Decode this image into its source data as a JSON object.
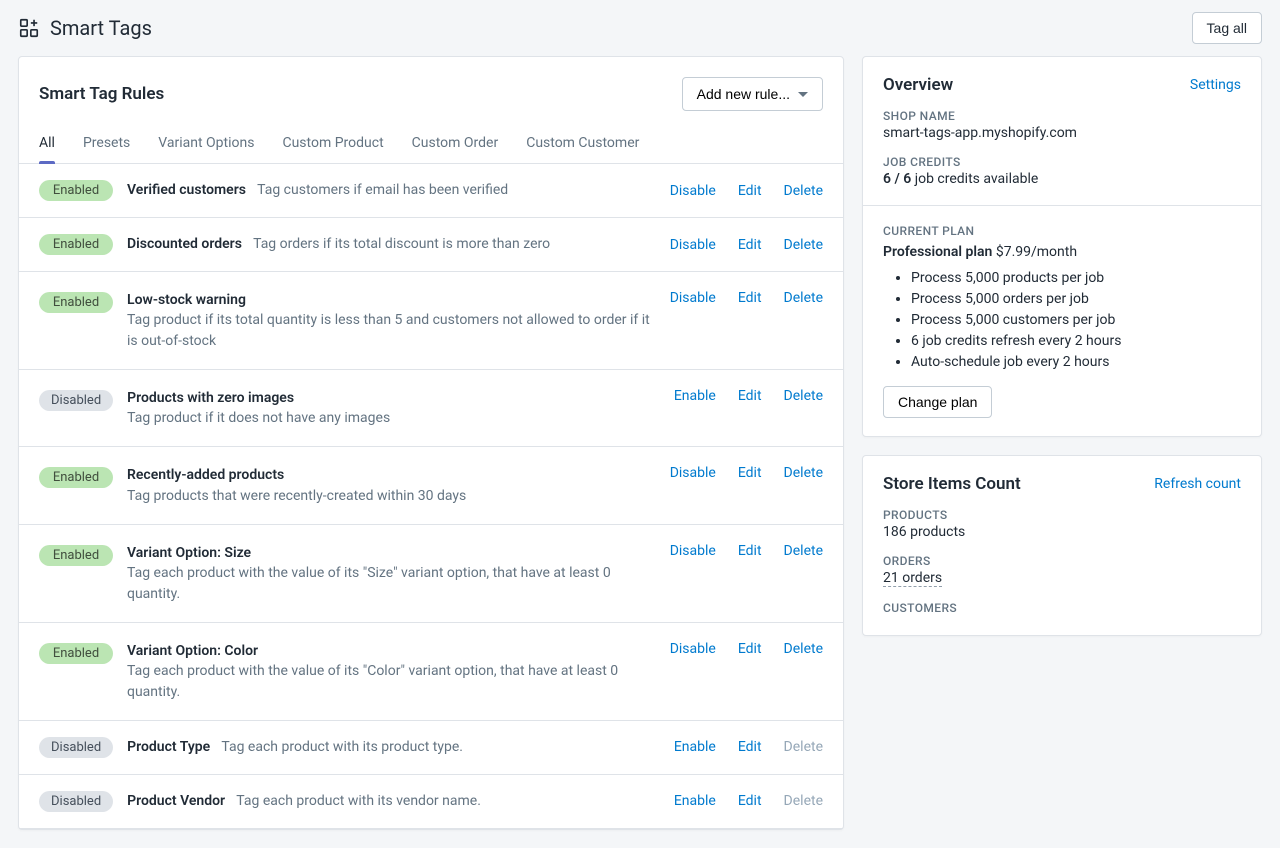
{
  "app_title": "Smart Tags",
  "tag_all_label": "Tag all",
  "rules_panel": {
    "title": "Smart Tag Rules",
    "add_rule_label": "Add new rule...",
    "tabs": [
      "All",
      "Presets",
      "Variant Options",
      "Custom Product",
      "Custom Order",
      "Custom Customer"
    ],
    "active_tab_index": 0,
    "rules": [
      {
        "status": "Enabled",
        "name": "Verified customers",
        "desc": "Tag customers if email has been verified",
        "toggle": "Disable",
        "edit": "Edit",
        "delete": "Delete",
        "delete_subdued": false,
        "multiline": false
      },
      {
        "status": "Enabled",
        "name": "Discounted orders",
        "desc": "Tag orders if its total discount is more than zero",
        "toggle": "Disable",
        "edit": "Edit",
        "delete": "Delete",
        "delete_subdued": false,
        "multiline": false
      },
      {
        "status": "Enabled",
        "name": "Low-stock warning",
        "desc": "Tag product if its total quantity is less than 5 and customers not al­lowed to order if it is out-of-stock",
        "toggle": "Disable",
        "edit": "Edit",
        "delete": "Delete",
        "delete_subdued": false,
        "multiline": true
      },
      {
        "status": "Disabled",
        "name": "Products with zero images",
        "desc": "Tag product if it does not have any images",
        "toggle": "Enable",
        "edit": "Edit",
        "delete": "Delete",
        "delete_subdued": false,
        "multiline": true
      },
      {
        "status": "Enabled",
        "name": "Recently-added products",
        "desc": "Tag products that were recently-created within 30 days",
        "toggle": "Disable",
        "edit": "Edit",
        "delete": "Delete",
        "delete_subdued": false,
        "multiline": true
      },
      {
        "status": "Enabled",
        "name": "Variant Option: Size",
        "desc": "Tag each product with the value of its \"Size\" variant option, that have at least 0 quantity.",
        "toggle": "Disable",
        "edit": "Edit",
        "delete": "Delete",
        "delete_subdued": false,
        "multiline": true
      },
      {
        "status": "Enabled",
        "name": "Variant Option: Color",
        "desc": "Tag each product with the value of its \"Color\" variant option, that have at least 0 quantity.",
        "toggle": "Disable",
        "edit": "Edit",
        "delete": "Delete",
        "delete_subdued": false,
        "multiline": true
      },
      {
        "status": "Disabled",
        "name": "Product Type",
        "desc": "Tag each product with its product type.",
        "toggle": "Enable",
        "edit": "Edit",
        "delete": "Delete",
        "delete_subdued": true,
        "multiline": false
      },
      {
        "status": "Disabled",
        "name": "Product Vendor",
        "desc": "Tag each product with its vendor name.",
        "toggle": "Enable",
        "edit": "Edit",
        "delete": "Delete",
        "delete_subdued": true,
        "multiline": false
      }
    ]
  },
  "overview": {
    "title": "Overview",
    "settings_label": "Settings",
    "shop_name_label": "SHOP NAME",
    "shop_name_value": "smart-tags-app.myshopify.com",
    "job_credits_label": "JOB CREDITS",
    "job_credits_bold": "6 / 6",
    "job_credits_rest": " job credits available",
    "current_plan_label": "CURRENT PLAN",
    "plan_name": "Professional plan",
    "plan_price": " $7.99/month",
    "features": [
      "Process 5,000 products per job",
      "Process 5,000 orders per job",
      "Process 5,000 customers per job",
      "6 job credits refresh every 2 hours",
      "Auto-schedule job every 2 hours"
    ],
    "change_plan_label": "Change plan"
  },
  "store_counts": {
    "title": "Store Items Count",
    "refresh_label": "Refresh count",
    "products_label": "PRODUCTS",
    "products_value": "186 products",
    "orders_label": "ORDERS",
    "orders_value": "21 orders",
    "customers_label": "CUSTOMERS"
  }
}
